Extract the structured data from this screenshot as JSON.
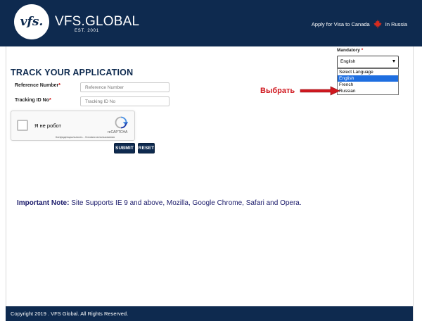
{
  "header": {
    "logo_text": "vfs.",
    "brand": "VFS.GLOBAL",
    "est": "EST. 2001",
    "apply_text": "Apply for Visa to Canada",
    "location_text": "In Russia"
  },
  "form": {
    "title": "TRACK YOUR APPLICATION",
    "reference": {
      "label": "Reference Number",
      "placeholder": "Reference Number",
      "value": ""
    },
    "tracking": {
      "label": "Tracking ID No",
      "placeholder": "Tracking ID No",
      "value": ""
    },
    "captcha": {
      "label": "Я не робот",
      "brand": "reCAPTCHA",
      "links": "Конфиденциальность - Условия использования"
    },
    "submit_label": "SUBMIT",
    "reset_label": "RESET"
  },
  "language": {
    "label": "Mandatory",
    "selected": "English",
    "options": [
      "Select Language",
      "English",
      "French",
      "Russian"
    ],
    "highlighted": "English"
  },
  "annotation": {
    "text": "Выбрать"
  },
  "note": {
    "label": "Important Note:",
    "text": " Site Supports IE 9 and above, Mozilla, Google Chrome, Safari and Opera."
  },
  "footer": {
    "text": "Copyright 2019 . VFS Global. All Rights Reserved."
  },
  "colors": {
    "navy": "#0e2a4f",
    "highlight": "#1e6ee0",
    "annotation": "#d0181f"
  },
  "icons": {
    "flag": "maple-leaf-icon",
    "captcha": "recaptcha-icon",
    "dropdown": "chevron-down-icon"
  }
}
